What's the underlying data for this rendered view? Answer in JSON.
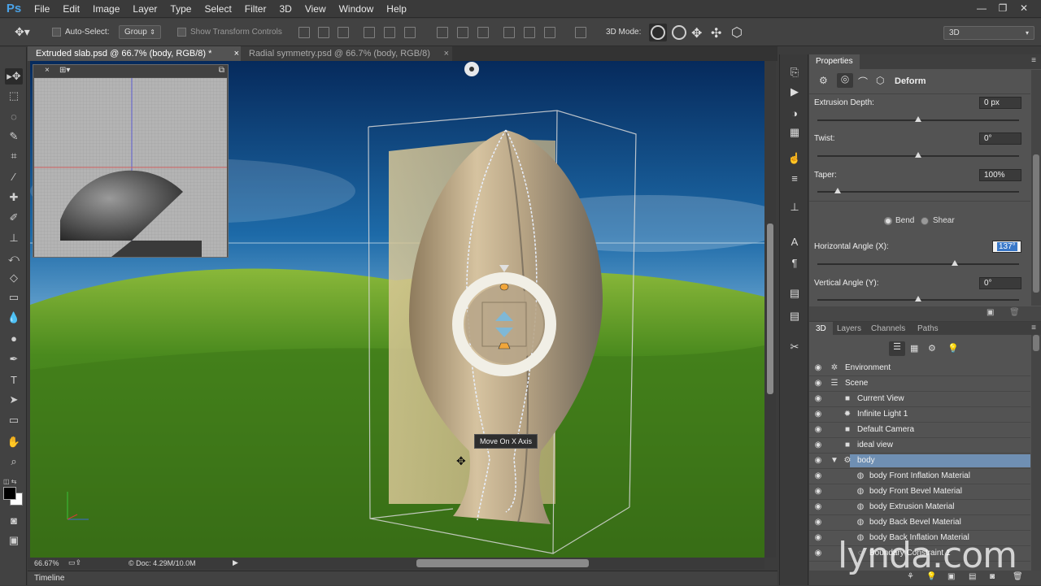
{
  "app": {
    "logo": "Ps"
  },
  "menu": [
    "File",
    "Edit",
    "Image",
    "Layer",
    "Type",
    "Select",
    "Filter",
    "3D",
    "View",
    "Window",
    "Help"
  ],
  "window_controls": {
    "minimize": "—",
    "restore": "❐",
    "close": "✕"
  },
  "options_bar": {
    "auto_select_label": "Auto-Select:",
    "auto_select_value": "Group",
    "show_transform_controls": "Show Transform Controls",
    "mode_3d_label": "3D Mode:",
    "workspace": "3D"
  },
  "tabs": [
    {
      "title": "Extruded slab.psd @ 66.7% (body, RGB/8) *",
      "close": "×"
    },
    {
      "title": "Radial symmetry.psd @ 66.7% (body, RGB/8)",
      "close": "×"
    }
  ],
  "canvas": {
    "tooltip": "Move On X Axis"
  },
  "status": {
    "zoom": "66.67%",
    "doc": "Doc: 4.29M/10.0M"
  },
  "timeline": {
    "label": "Timeline"
  },
  "properties": {
    "tab": "Properties",
    "mode": "Deform",
    "fields": [
      {
        "label": "Extrusion Depth:",
        "value": "0 px",
        "level": 0.5
      },
      {
        "label": "Twist:",
        "value": "0°",
        "level": 0.5
      },
      {
        "label": "Taper:",
        "value": "100%",
        "level": 0.1
      },
      {
        "label": "Horizontal Angle (X):",
        "value": "137°",
        "level": 0.68
      },
      {
        "label": "Vertical Angle (Y):",
        "value": "0°",
        "level": 0.5
      }
    ],
    "bend_label": "Bend",
    "shear_label": "Shear",
    "bend_selected": true
  },
  "layers_panel": {
    "tabs": [
      "3D",
      "Layers",
      "Channels",
      "Paths"
    ],
    "rows": [
      {
        "label": "Environment",
        "icon": "environment-icon",
        "indent": 0,
        "eye": true
      },
      {
        "label": "Scene",
        "icon": "scene-icon",
        "indent": 0,
        "eye": true
      },
      {
        "label": "Current View",
        "icon": "camera-icon",
        "indent": 1,
        "eye": true
      },
      {
        "label": "Infinite Light 1",
        "icon": "light-icon",
        "indent": 1,
        "eye": true
      },
      {
        "label": "Default Camera",
        "icon": "camera-icon",
        "indent": 1,
        "eye": true
      },
      {
        "label": "ideal view",
        "icon": "camera-icon",
        "indent": 1,
        "eye": true
      },
      {
        "label": "body",
        "icon": "mesh-icon",
        "indent": 1,
        "eye": true,
        "selected": true
      },
      {
        "label": "body Front Inflation Material",
        "icon": "material-icon",
        "indent": 2,
        "eye": true
      },
      {
        "label": "body Front Bevel Material",
        "icon": "material-icon",
        "indent": 2,
        "eye": true
      },
      {
        "label": "body Extrusion Material",
        "icon": "material-icon",
        "indent": 2,
        "eye": true
      },
      {
        "label": "body Back Bevel Material",
        "icon": "material-icon",
        "indent": 2,
        "eye": true
      },
      {
        "label": "body Back Inflation Material",
        "icon": "material-icon",
        "indent": 2,
        "eye": true
      },
      {
        "label": "Boundary Constraint 1",
        "icon": "constraint-icon",
        "indent": 2,
        "eye": true
      }
    ]
  },
  "watermark": "lynda.com",
  "colors": {
    "selection": "#6f8fb3",
    "panel": "#535353",
    "accent_blue": "#4aa3e8"
  }
}
